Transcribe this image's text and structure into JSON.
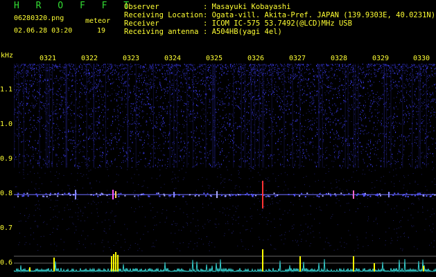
{
  "header": {
    "logo": "H R O F F T",
    "filename": "06280320.png",
    "timestamp": "02.06.28 03:20",
    "meteor_label": "meteor",
    "meteor_count": "19"
  },
  "info": {
    "observer_label": "Observer",
    "observer_value": ": Masayuki Kobayashi",
    "location_label": "Receiving Location",
    "location_value": ": Ogata-vill. Akita-Pref. JAPAN (139.9303E, 40.0231N)",
    "receiver_label": "Receiver",
    "receiver_value": ": ICOM IC-575 53.7492(@LCD)MHz USB",
    "antenna_label": "Receiving antenna",
    "antenna_value": ": A504HB(yagi 4el)"
  },
  "axis": {
    "unit": "kHz",
    "time_ticks": [
      "0321",
      "0322",
      "0323",
      "0324",
      "0325",
      "0326",
      "0327",
      "0328",
      "0329",
      "0330"
    ],
    "freq_ticks": [
      "1.1",
      "1.0",
      "0.9",
      "0.8",
      "0.7",
      "0.6"
    ]
  },
  "colors": {
    "background": "#000000",
    "label": "#ffff33",
    "logo": "#33dd33",
    "noise": "#2222aa",
    "signal_line": "#2a2a5a",
    "trace": "#33cccc",
    "peak": "#ffff00"
  }
}
